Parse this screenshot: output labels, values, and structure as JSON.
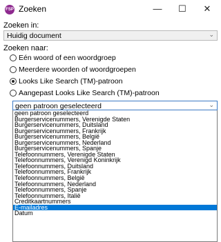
{
  "window": {
    "title": "Zoeken",
    "app_icon_text": "FSP",
    "minimize_glyph": "—",
    "maximize_glyph": "☐",
    "close_glyph": "✕"
  },
  "search_in": {
    "label": "Zoeken in:",
    "value": "Huidig document"
  },
  "search_for": {
    "label": "Zoeken naar:",
    "options": [
      {
        "label": "Eén woord of een woordgroep",
        "checked": false
      },
      {
        "label": "Meerdere woorden of woordgroepen",
        "checked": false
      },
      {
        "label": "Looks Like Search (TM)-patroon",
        "checked": true
      },
      {
        "label": "Aangepast Looks Like Search (TM)-patroon",
        "checked": false
      }
    ]
  },
  "pattern": {
    "value": "geen patroon geselecteerd",
    "items": [
      "geen patroon geselecteerd",
      "Burgerservicenummers, Verenigde Staten",
      "Burgerservicenummers, Duitsland",
      "Burgerservicenummers, Frankrijk",
      "Burgerservicenummers, België",
      "Burgerservicenummers, Nederland",
      "Burgerservicenummers, Spanje",
      "Telefoonnummers, Verenigde Staten",
      "Telefoonnummers, Verenigd Koninkrijk",
      "Telefoonnummers, Duitsland",
      "Telefoonnummers, Frankrijk",
      "Telefoonnummers, België",
      "Telefoonnummers, Nederland",
      "Telefoonnummers, Spanje",
      "Telefoonnummers, Italië",
      "Creditkaartnummers",
      "E-mailadres",
      "Datum"
    ],
    "highlighted": "E-mailadres"
  },
  "colors": {
    "accent": "#0078d7",
    "app_icon": "#8e2a8f"
  }
}
